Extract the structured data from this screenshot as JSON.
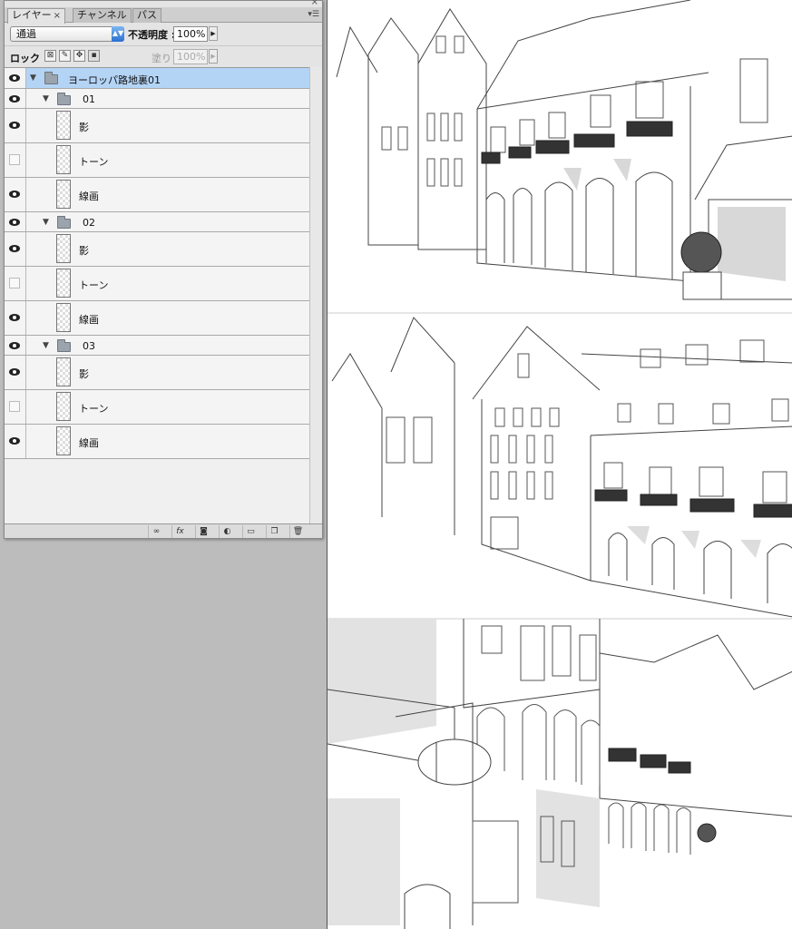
{
  "panel": {
    "tabs": [
      {
        "label": "レイヤー",
        "active": true
      },
      {
        "label": "チャンネル",
        "active": false
      },
      {
        "label": "パス",
        "active": false
      }
    ],
    "blend_mode": "通過",
    "opacity_label": "不透明度 :",
    "opacity_value": "100%",
    "lock_label": "ロック :",
    "fill_label": "塗り :",
    "fill_value": "100%",
    "layers": [
      {
        "name": "ヨーロッパ路地裏01",
        "type": "group",
        "visible": true,
        "selected": true
      },
      {
        "name": "01",
        "type": "group",
        "visible": true
      },
      {
        "name": "影",
        "type": "layer",
        "visible": true
      },
      {
        "name": "トーン",
        "type": "layer",
        "visible": false
      },
      {
        "name": "線画",
        "type": "layer",
        "visible": true
      },
      {
        "name": "02",
        "type": "group",
        "visible": true
      },
      {
        "name": "影",
        "type": "layer",
        "visible": true
      },
      {
        "name": "トーン",
        "type": "layer",
        "visible": false
      },
      {
        "name": "線画",
        "type": "layer",
        "visible": true
      },
      {
        "name": "03",
        "type": "group",
        "visible": true
      },
      {
        "name": "影",
        "type": "layer",
        "visible": true
      },
      {
        "name": "トーン",
        "type": "layer",
        "visible": false
      },
      {
        "name": "線画",
        "type": "layer",
        "visible": true
      }
    ],
    "bottom_icons": [
      "link-icon",
      "fx-icon",
      "mask-icon",
      "adjustment-icon",
      "new-group-icon",
      "new-layer-icon",
      "trash-icon"
    ]
  }
}
